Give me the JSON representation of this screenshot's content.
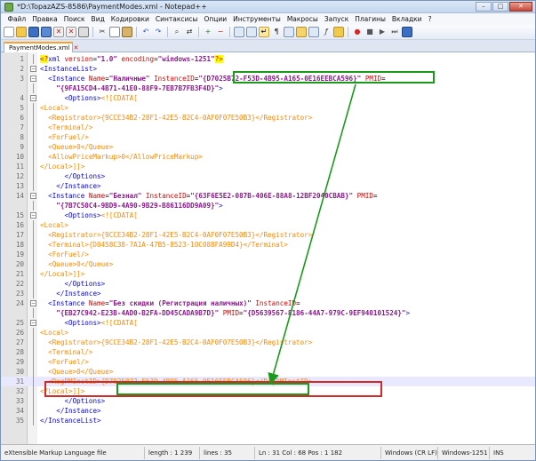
{
  "window": {
    "title": "*D:\\TopazAZS-8586\\PaymentModes.xml - Notepad++",
    "buttons": {
      "minimize": "–",
      "maximize": "□",
      "close": "✕"
    }
  },
  "menu": [
    "Файл",
    "Правка",
    "Поиск",
    "Вид",
    "Кодировки",
    "Синтаксисы",
    "Опции",
    "Инструменты",
    "Макросы",
    "Запуск",
    "Плагины",
    "Вкладки",
    "?"
  ],
  "tab": {
    "label": "PaymentModes.xml",
    "close": "✕"
  },
  "editor": {
    "current_line": 31,
    "lines": [
      {
        "n": "1",
        "fold": "",
        "segs": [
          [
            "pi",
            "<?"
          ],
          [
            "t-tag",
            "xml "
          ],
          [
            "t-attr",
            "version"
          ],
          [
            "t-plain",
            "="
          ],
          [
            "t-val",
            "\"1.0\""
          ],
          [
            "t-plain",
            " "
          ],
          [
            "t-attr",
            "encoding"
          ],
          [
            "t-plain",
            "="
          ],
          [
            "t-val",
            "\"windows-1251\""
          ],
          [
            "pi",
            "?>"
          ]
        ]
      },
      {
        "n": "2",
        "fold": "minus",
        "segs": [
          [
            "t-bracket",
            "<"
          ],
          [
            "t-tag",
            "InstanceList"
          ],
          [
            "t-bracket",
            ">"
          ]
        ]
      },
      {
        "n": "3",
        "fold": "minus",
        "segs": [
          [
            "t-plain",
            "  "
          ],
          [
            "t-bracket",
            "<"
          ],
          [
            "t-tag",
            "Instance "
          ],
          [
            "t-attr",
            "Name"
          ],
          [
            "t-plain",
            "="
          ],
          [
            "t-val",
            "\"Наличные\""
          ],
          [
            "t-plain",
            " "
          ],
          [
            "t-attr",
            "InstanceID"
          ],
          [
            "t-plain",
            "="
          ],
          [
            "t-val",
            "\"{D7025B72-F53D-4B95-A165-0E16EEBCA596}\""
          ],
          [
            "t-plain",
            " "
          ],
          [
            "t-attr",
            "PMID"
          ],
          [
            "t-plain",
            "="
          ]
        ]
      },
      {
        "n": "",
        "fold": "",
        "segs": [
          [
            "t-plain",
            "    "
          ],
          [
            "t-val",
            "\"{9FA15CD4-4B71-41E0-88F9-7EB7B7FB3F4D}\""
          ],
          [
            "t-bracket",
            ">"
          ]
        ]
      },
      {
        "n": "4",
        "fold": "minus",
        "segs": [
          [
            "t-plain",
            "      "
          ],
          [
            "t-bracket",
            "<"
          ],
          [
            "t-tag",
            "Options"
          ],
          [
            "t-bracket",
            ">"
          ],
          [
            "t-cdata",
            "<![CDATA["
          ]
        ]
      },
      {
        "n": "5",
        "fold": "",
        "segs": [
          [
            "t-cdata",
            "<Local>"
          ]
        ]
      },
      {
        "n": "6",
        "fold": "",
        "segs": [
          [
            "t-cdata",
            "  <Registrator>{9CCE34B2-28F1-42E5-B2C4-0AF0F07E50B3}</Registrator>"
          ]
        ]
      },
      {
        "n": "7",
        "fold": "",
        "segs": [
          [
            "t-cdata",
            "  <Terminal/>"
          ]
        ]
      },
      {
        "n": "8",
        "fold": "",
        "segs": [
          [
            "t-cdata",
            "  <ForFuel/>"
          ]
        ]
      },
      {
        "n": "9",
        "fold": "",
        "segs": [
          [
            "t-cdata",
            "  <Queue>0</Queue>"
          ]
        ]
      },
      {
        "n": "10",
        "fold": "",
        "segs": [
          [
            "t-cdata",
            "  <AllowPriceMarkup>0</AllowPriceMarkup>"
          ]
        ]
      },
      {
        "n": "11",
        "fold": "",
        "segs": [
          [
            "t-cdata",
            "</Local>]]>"
          ]
        ]
      },
      {
        "n": "12",
        "fold": "",
        "segs": [
          [
            "t-plain",
            "      "
          ],
          [
            "t-bracket",
            "</"
          ],
          [
            "t-tag",
            "Options"
          ],
          [
            "t-bracket",
            ">"
          ]
        ]
      },
      {
        "n": "13",
        "fold": "",
        "segs": [
          [
            "t-plain",
            "    "
          ],
          [
            "t-bracket",
            "</"
          ],
          [
            "t-tag",
            "Instance"
          ],
          [
            "t-bracket",
            ">"
          ]
        ]
      },
      {
        "n": "14",
        "fold": "minus",
        "segs": [
          [
            "t-plain",
            "  "
          ],
          [
            "t-bracket",
            "<"
          ],
          [
            "t-tag",
            "Instance "
          ],
          [
            "t-attr",
            "Name"
          ],
          [
            "t-plain",
            "="
          ],
          [
            "t-val",
            "\"Безнал\""
          ],
          [
            "t-plain",
            " "
          ],
          [
            "t-attr",
            "InstanceID"
          ],
          [
            "t-plain",
            "="
          ],
          [
            "t-val",
            "\"{63F6E5E2-087B-406E-88A8-12BF2040CBAB}\""
          ],
          [
            "t-plain",
            " "
          ],
          [
            "t-attr",
            "PMID"
          ],
          [
            "t-plain",
            "="
          ]
        ]
      },
      {
        "n": "",
        "fold": "",
        "segs": [
          [
            "t-plain",
            "    "
          ],
          [
            "t-val",
            "\"{7B7C50C4-9BD9-4A90-9B29-B86116DD9A09}\""
          ],
          [
            "t-bracket",
            ">"
          ]
        ]
      },
      {
        "n": "15",
        "fold": "minus",
        "segs": [
          [
            "t-plain",
            "      "
          ],
          [
            "t-bracket",
            "<"
          ],
          [
            "t-tag",
            "Options"
          ],
          [
            "t-bracket",
            ">"
          ],
          [
            "t-cdata",
            "<![CDATA["
          ]
        ]
      },
      {
        "n": "16",
        "fold": "",
        "segs": [
          [
            "t-cdata",
            "<Local>"
          ]
        ]
      },
      {
        "n": "17",
        "fold": "",
        "segs": [
          [
            "t-cdata",
            "  <Registrator>{9CCE34B2-28F1-42E5-B2C4-0AF0F07E50B3}</Registrator>"
          ]
        ]
      },
      {
        "n": "18",
        "fold": "",
        "segs": [
          [
            "t-cdata",
            "  <Terminal>{D0458C38-7A1A-47B5-8523-10C088FA99D4}</Terminal>"
          ]
        ]
      },
      {
        "n": "19",
        "fold": "",
        "segs": [
          [
            "t-cdata",
            "  <ForFuel/>"
          ]
        ]
      },
      {
        "n": "20",
        "fold": "",
        "segs": [
          [
            "t-cdata",
            "  <Queue>0</Queue>"
          ]
        ]
      },
      {
        "n": "21",
        "fold": "",
        "segs": [
          [
            "t-cdata",
            "</Local>]]>"
          ]
        ]
      },
      {
        "n": "22",
        "fold": "",
        "segs": [
          [
            "t-plain",
            "      "
          ],
          [
            "t-bracket",
            "</"
          ],
          [
            "t-tag",
            "Options"
          ],
          [
            "t-bracket",
            ">"
          ]
        ]
      },
      {
        "n": "23",
        "fold": "",
        "segs": [
          [
            "t-plain",
            "    "
          ],
          [
            "t-bracket",
            "</"
          ],
          [
            "t-tag",
            "Instance"
          ],
          [
            "t-bracket",
            ">"
          ]
        ]
      },
      {
        "n": "24",
        "fold": "minus",
        "segs": [
          [
            "t-plain",
            "  "
          ],
          [
            "t-bracket",
            "<"
          ],
          [
            "t-tag",
            "Instance "
          ],
          [
            "t-attr",
            "Name"
          ],
          [
            "t-plain",
            "="
          ],
          [
            "t-val",
            "\"Без скидки (Регистрация наличных)\""
          ],
          [
            "t-plain",
            " "
          ],
          [
            "t-attr",
            "InstanceID"
          ],
          [
            "t-plain",
            "="
          ]
        ]
      },
      {
        "n": "",
        "fold": "",
        "segs": [
          [
            "t-plain",
            "    "
          ],
          [
            "t-val",
            "\"{EB27C942-E23B-4AD0-B2FA-DD45CADA9B7D}\""
          ],
          [
            "t-plain",
            " "
          ],
          [
            "t-attr",
            "PMID"
          ],
          [
            "t-plain",
            "="
          ],
          [
            "t-val",
            "\"{D5639567-8186-44A7-979C-9EF940101524}\""
          ],
          [
            "t-bracket",
            ">"
          ]
        ]
      },
      {
        "n": "25",
        "fold": "minus",
        "segs": [
          [
            "t-plain",
            "      "
          ],
          [
            "t-bracket",
            "<"
          ],
          [
            "t-tag",
            "Options"
          ],
          [
            "t-bracket",
            ">"
          ],
          [
            "t-cdata",
            "<![CDATA["
          ]
        ]
      },
      {
        "n": "26",
        "fold": "",
        "segs": [
          [
            "t-cdata",
            "<Local>"
          ]
        ]
      },
      {
        "n": "27",
        "fold": "",
        "segs": [
          [
            "t-cdata",
            "  <Registrator>{9CCE34B2-28F1-42E5-B2C4-0AF0F07E50B3}</Registrator>"
          ]
        ]
      },
      {
        "n": "28",
        "fold": "",
        "segs": [
          [
            "t-cdata",
            "  <Terminal/>"
          ]
        ]
      },
      {
        "n": "29",
        "fold": "",
        "segs": [
          [
            "t-cdata",
            "  <ForFuel/>"
          ]
        ]
      },
      {
        "n": "30",
        "fold": "",
        "segs": [
          [
            "t-cdata",
            "  <Queue>0</Queue>"
          ]
        ]
      },
      {
        "n": "31",
        "fold": "",
        "segs": [
          [
            "t-cdata",
            "  <RegPMInstID>{D7025B72-F53D-4B95-A165-0E16EEBCA596}</RegPMInstID>"
          ]
        ]
      },
      {
        "n": "32",
        "fold": "",
        "segs": [
          [
            "t-cdata",
            "</Local>]]>"
          ]
        ]
      },
      {
        "n": "33",
        "fold": "",
        "segs": [
          [
            "t-plain",
            "      "
          ],
          [
            "t-bracket",
            "</"
          ],
          [
            "t-tag",
            "Options"
          ],
          [
            "t-bracket",
            ">"
          ]
        ]
      },
      {
        "n": "34",
        "fold": "",
        "segs": [
          [
            "t-plain",
            "    "
          ],
          [
            "t-bracket",
            "</"
          ],
          [
            "t-tag",
            "Instance"
          ],
          [
            "t-bracket",
            ">"
          ]
        ]
      },
      {
        "n": "35",
        "fold": "",
        "segs": [
          [
            "t-bracket",
            "</"
          ],
          [
            "t-tag",
            "InstanceList"
          ],
          [
            "t-bracket",
            ">"
          ]
        ]
      }
    ]
  },
  "status": {
    "filetype": "eXtensible Markup Language file",
    "length": "length : 1 239",
    "lines": "lines : 35",
    "position": "Ln : 31    Col : 68    Pos : 1 182",
    "eol": "Windows (CR LF)",
    "encoding": "Windows-1251",
    "mode": "INS"
  },
  "colors": {
    "highlight_green": "#1a9a1a",
    "highlight_red": "#d42a2a",
    "arrow": "#1a9a1a"
  }
}
